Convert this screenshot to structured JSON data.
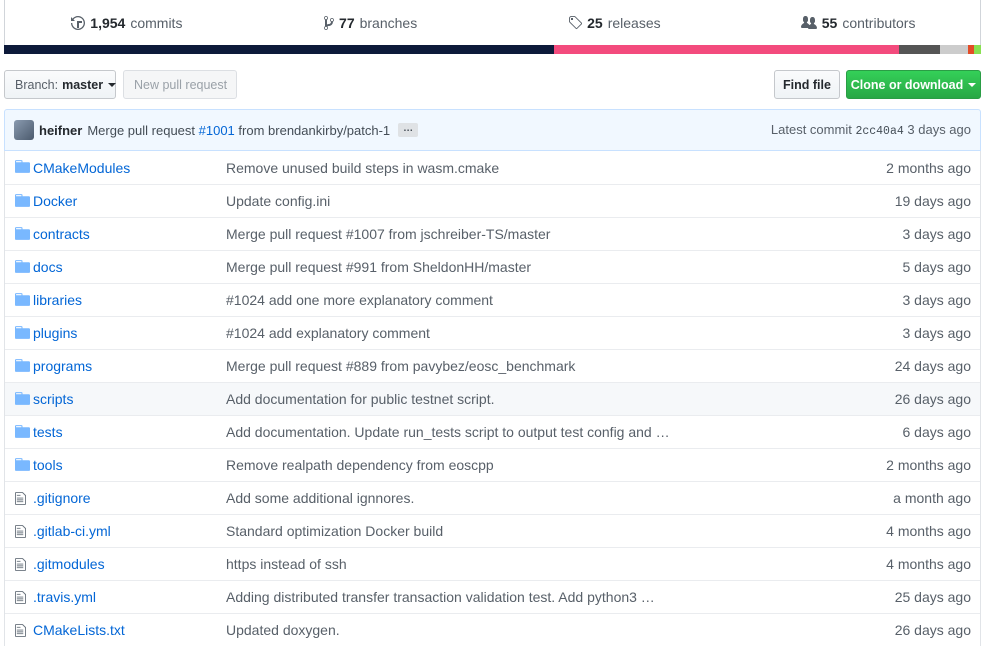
{
  "summary": {
    "commits": {
      "count": "1,954",
      "label": "commits",
      "icon": "history-icon"
    },
    "branches": {
      "count": "77",
      "label": "branches",
      "icon": "branch-icon"
    },
    "releases": {
      "count": "25",
      "label": "releases",
      "icon": "tag-icon"
    },
    "contributors": {
      "count": "55",
      "label": "contributors",
      "icon": "people-icon"
    }
  },
  "language_bar": [
    {
      "color": "#0d1a3a",
      "share": 56.3
    },
    {
      "color": "#f34b7d",
      "share": 35.3
    },
    {
      "color": "#555555",
      "share": 4.2
    },
    {
      "color": "#cccccc",
      "share": 2.9
    },
    {
      "color": "#e34c26",
      "share": 0.6
    },
    {
      "color": "#89e051",
      "share": 0.7
    }
  ],
  "toolbar": {
    "branch_prefix": "Branch:",
    "branch_name": "master",
    "new_pull_request": "New pull request",
    "find_file": "Find file",
    "clone_or_download": "Clone or download"
  },
  "latest_commit": {
    "author": "heifner",
    "message_prefix": "Merge pull request",
    "pr_link": "#1001",
    "message_suffix": "from brendankirby/patch-1",
    "ellipsis": "…",
    "latest_label": "Latest commit",
    "sha": "2cc40a4",
    "age": "3 days ago"
  },
  "files": [
    {
      "type": "dir",
      "name": "CMakeModules",
      "message": "Remove unused build steps in wasm.cmake",
      "age": "2 months ago"
    },
    {
      "type": "dir",
      "name": "Docker",
      "message": "Update config.ini",
      "age": "19 days ago"
    },
    {
      "type": "dir",
      "name": "contracts",
      "message": "Merge pull request #1007 from jschreiber-TS/master",
      "age": "3 days ago"
    },
    {
      "type": "dir",
      "name": "docs",
      "message": "Merge pull request #991 from SheldonHH/master",
      "age": "5 days ago"
    },
    {
      "type": "dir",
      "name": "libraries",
      "message": "#1024 add one more explanatory comment",
      "age": "3 days ago"
    },
    {
      "type": "dir",
      "name": "plugins",
      "message": "#1024 add explanatory comment",
      "age": "3 days ago"
    },
    {
      "type": "dir",
      "name": "programs",
      "message": "Merge pull request #889 from pavybez/eosc_benchmark",
      "age": "24 days ago"
    },
    {
      "type": "dir",
      "name": "scripts",
      "message": "Add documentation for public testnet script.",
      "age": "26 days ago"
    },
    {
      "type": "dir",
      "name": "tests",
      "message": "Add documentation. Update run_tests script to output test config and …",
      "age": "6 days ago"
    },
    {
      "type": "dir",
      "name": "tools",
      "message": "Remove realpath dependency from eoscpp",
      "age": "2 months ago"
    },
    {
      "type": "file",
      "name": ".gitignore",
      "message": "Add some additional ignnores.",
      "age": "a month ago"
    },
    {
      "type": "file",
      "name": ".gitlab-ci.yml",
      "message": "Standard optimization Docker build",
      "age": "4 months ago"
    },
    {
      "type": "file",
      "name": ".gitmodules",
      "message": "https instead of ssh",
      "age": "4 months ago"
    },
    {
      "type": "file",
      "name": ".travis.yml",
      "message": "Adding distributed transfer transaction validation test. Add python3 …",
      "age": "25 days ago"
    },
    {
      "type": "file",
      "name": "CMakeLists.txt",
      "message": "Updated doxygen.",
      "age": "26 days ago"
    }
  ]
}
